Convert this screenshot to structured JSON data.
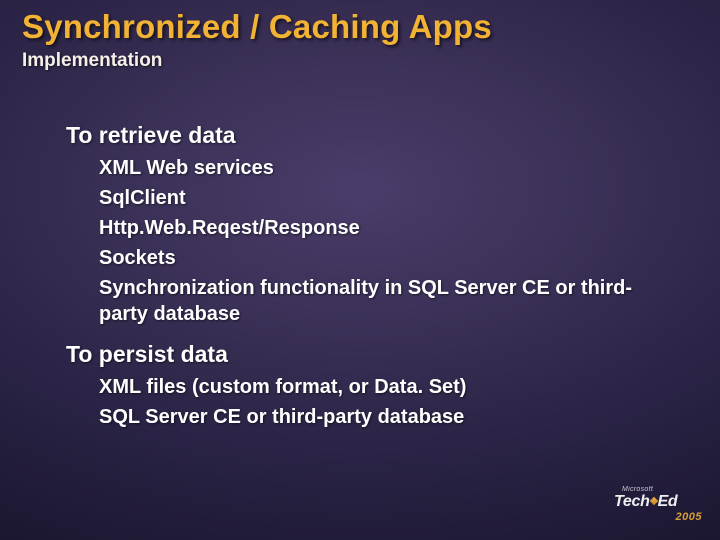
{
  "title": "Synchronized / Caching Apps",
  "subtitle": "Implementation",
  "sections": [
    {
      "heading": "To retrieve data",
      "items": [
        "XML Web services",
        "SqlClient",
        "Http.Web.Reqest/Response",
        "Sockets",
        "Synchronization functionality in SQL Server CE or third-party database"
      ]
    },
    {
      "heading": "To persist data",
      "items": [
        "XML files (custom format, or Data. Set)",
        "SQL Server CE or third-party database"
      ]
    }
  ],
  "logo": {
    "vendor": "Microsoft",
    "brand_a": "Tech",
    "brand_b": "Ed",
    "year": "2005"
  }
}
